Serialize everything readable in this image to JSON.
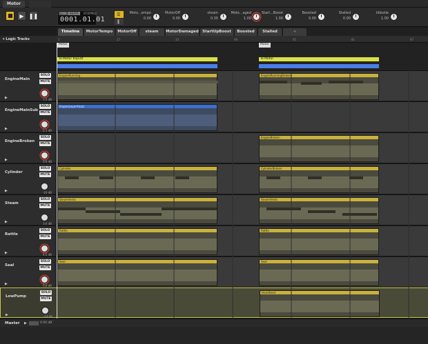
{
  "window": {
    "tabs": [
      {
        "label": "Motor",
        "active": true
      },
      {
        "label": "",
        "active": false
      }
    ]
  },
  "transport": {
    "time_labels": [
      "TIME",
      "BEATS",
      "STOPPED"
    ],
    "time_value": "0001.01.01",
    "parameters": [
      {
        "label": "Moto...empo",
        "value": "0.00"
      },
      {
        "label": "MotorOff",
        "value": "0.00"
      },
      {
        "label": "steam",
        "value": "0.30"
      },
      {
        "label": "Moto...aged",
        "value": "1.00"
      },
      {
        "label": "Start...Boost",
        "value": "1.00"
      },
      {
        "label": "Boosted",
        "value": "0.00"
      },
      {
        "label": "Stalled",
        "value": "0.00"
      },
      {
        "label": "Idlestie",
        "value": "1.00"
      }
    ]
  },
  "event_tabs": [
    "Timeline",
    "MotorTempo",
    "MotorOff",
    "steam",
    "MotorDamaged",
    "StartUpBoost",
    "Boosted",
    "Stalled"
  ],
  "logic_tracks_label": "Logic Tracks",
  "ruler_ticks": [
    "1",
    "17",
    "33",
    "49",
    "65",
    "81",
    "97"
  ],
  "markers": [
    {
      "label": "Motor"
    },
    {
      "label": "Motor"
    }
  ],
  "transitions": [
    {
      "label": "To Motor Kaputt"
    },
    {
      "label": "To Motor"
    }
  ],
  "tracks": [
    {
      "name": "EngineMain",
      "db": "1.5 dB",
      "instruments": [
        "EngineRunning",
        "EngineRunningBroken"
      ]
    },
    {
      "name": "EngineMainSub",
      "db": "-2.1 dB",
      "instruments": [
        "EngineLayerAlsub"
      ]
    },
    {
      "name": "EngineBroken",
      "db": "0.0 dB",
      "instruments": [
        "EngineBroken"
      ]
    },
    {
      "name": "Cylinder",
      "db": "-10 dB",
      "instruments": [
        "Cylinder",
        "CylinderBroken"
      ]
    },
    {
      "name": "Steam",
      "db": "3.0 dB",
      "instruments": [
        "SteamVents",
        "SteamVents"
      ]
    },
    {
      "name": "Rattle",
      "db": "4.5 dB",
      "instruments": [
        "Rattle",
        "Rattle"
      ]
    },
    {
      "name": "Seal",
      "db": "0.0 dB",
      "instruments": [
        "Seal",
        "Seal"
      ]
    },
    {
      "name": "LowPump",
      "db": "-14 dB",
      "instruments": [
        "Heartbeat"
      ]
    }
  ],
  "solo_label": "SOLO",
  "mute_label": "MUTE",
  "master": {
    "name": "Master",
    "readout": "0.00 dB"
  }
}
